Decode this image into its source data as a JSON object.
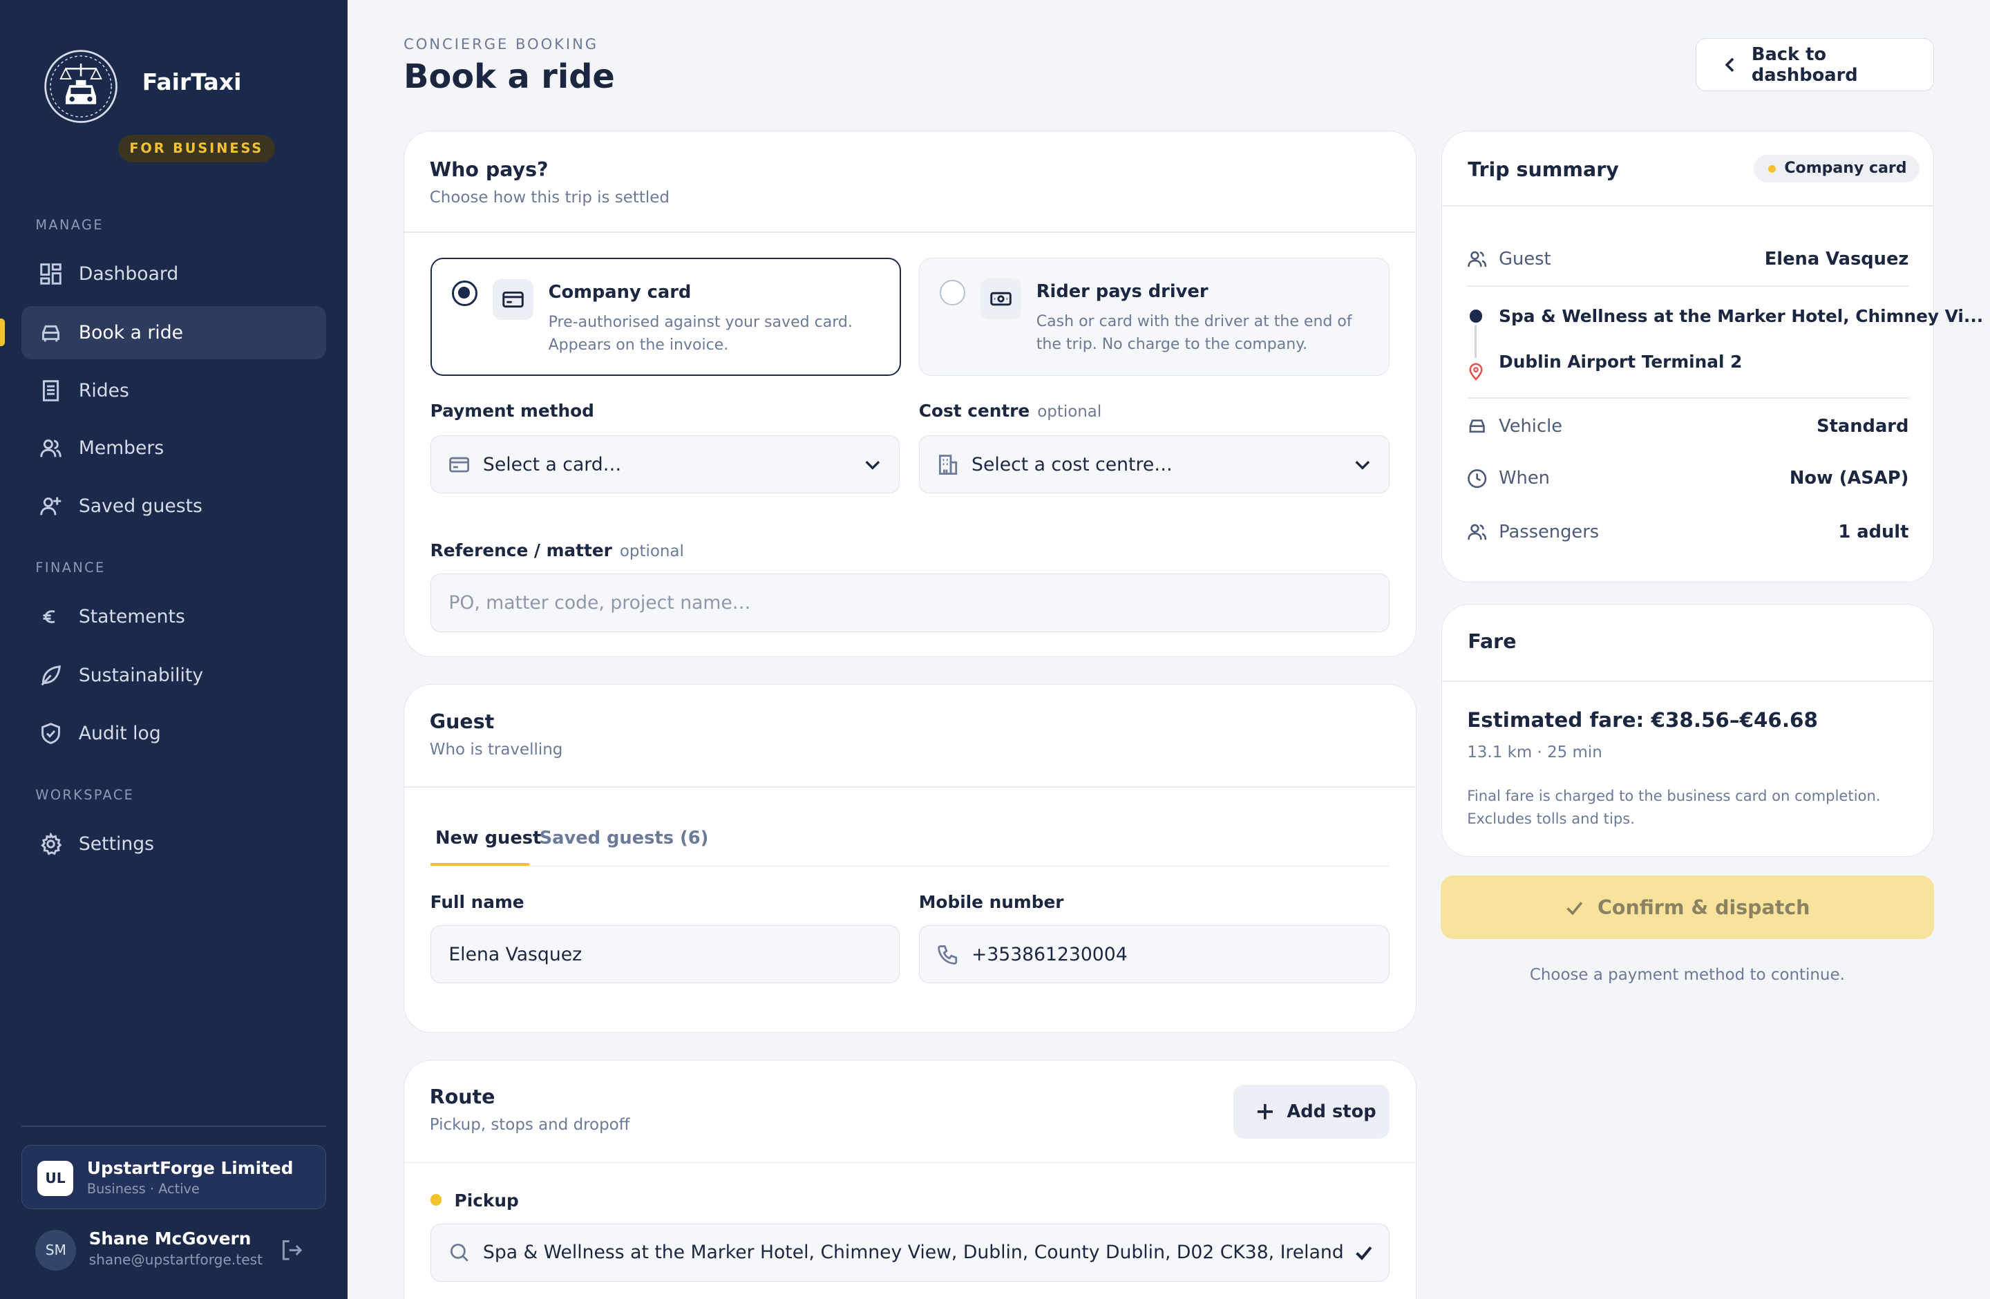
{
  "brand": {
    "name": "FairTaxi",
    "badge": "FOR BUSINESS"
  },
  "sidebar": {
    "sections": {
      "manage": "MANAGE",
      "finance": "FINANCE",
      "workspace": "WORKSPACE"
    },
    "items": [
      {
        "label": "Dashboard",
        "icon": "dashboard-icon"
      },
      {
        "label": "Book a ride",
        "icon": "car-icon",
        "active": true
      },
      {
        "label": "Rides",
        "icon": "receipt-icon"
      },
      {
        "label": "Members",
        "icon": "users-icon"
      },
      {
        "label": "Saved guests",
        "icon": "user-plus-icon"
      },
      {
        "label": "Statements",
        "icon": "euro-icon"
      },
      {
        "label": "Sustainability",
        "icon": "leaf-icon"
      },
      {
        "label": "Audit log",
        "icon": "shield-check-icon"
      },
      {
        "label": "Settings",
        "icon": "gear-icon"
      }
    ],
    "org": {
      "initials": "UL",
      "name": "UpstartForge Limited",
      "sub": "Business · Active"
    },
    "user": {
      "initials": "SM",
      "name": "Shane McGovern",
      "email": "shane@upstartforge.test"
    }
  },
  "header": {
    "eyebrow": "CONCIERGE BOOKING",
    "title": "Book a ride",
    "back_label": "Back to dashboard"
  },
  "who_pays": {
    "title": "Who pays?",
    "subtitle": "Choose how this trip is settled",
    "options": [
      {
        "title": "Company card",
        "desc": "Pre-authorised against your saved card. Appears on the invoice.",
        "selected": true
      },
      {
        "title": "Rider pays driver",
        "desc": "Cash or card with the driver at the end of the trip. No charge to the company.",
        "selected": false
      }
    ],
    "payment_method": {
      "label": "Payment method",
      "value": "Select a card…"
    },
    "cost_centre": {
      "label": "Cost centre",
      "optional": "optional",
      "value": "Select a cost centre…"
    },
    "reference": {
      "label": "Reference / matter",
      "optional": "optional",
      "placeholder": "PO, matter code, project name…"
    }
  },
  "guest": {
    "title": "Guest",
    "subtitle": "Who is travelling",
    "tabs": [
      "New guest",
      "Saved guests (6)"
    ],
    "full_name": {
      "label": "Full name",
      "value": "Elena Vasquez"
    },
    "mobile": {
      "label": "Mobile number",
      "value": "+353861230004"
    }
  },
  "route": {
    "title": "Route",
    "subtitle": "Pickup, stops and dropoff",
    "add_stop": "Add stop",
    "pickup_label": "Pickup",
    "pickup_value": "Spa & Wellness at the Marker Hotel, Chimney View, Dublin, County Dublin, D02 CK38, Ireland"
  },
  "summary": {
    "title": "Trip summary",
    "badge": "Company card",
    "guest": {
      "k": "Guest",
      "v": "Elena Vasquez"
    },
    "pickup": "Spa & Wellness at the Marker Hotel, Chimney Vi...",
    "dropoff": "Dublin Airport Terminal 2",
    "vehicle": {
      "k": "Vehicle",
      "v": "Standard"
    },
    "when": {
      "k": "When",
      "v": "Now (ASAP)"
    },
    "passengers": {
      "k": "Passengers",
      "v": "1 adult"
    }
  },
  "fare": {
    "title": "Fare",
    "estimate": "Estimated fare: €38.56–€46.68",
    "meta": "13.1 km · 25 min",
    "note": "Final fare is charged to the business card on completion. Excludes tolls and tips."
  },
  "confirm": {
    "label": "Confirm & dispatch",
    "hint": "Choose a payment method to continue."
  },
  "colors": {
    "sidebar": "#1b2a4b",
    "accent": "#f2c230",
    "confirm_disabled": "#f8e39c"
  }
}
